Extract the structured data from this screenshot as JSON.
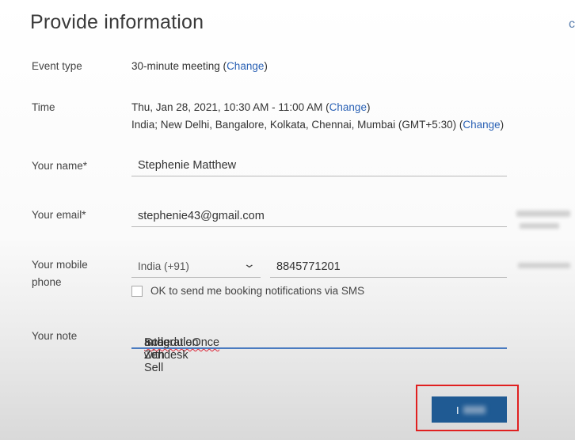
{
  "page": {
    "title": "Provide information",
    "edge_glyph": "c"
  },
  "event_type": {
    "label": "Event type",
    "value": "30-minute meeting (",
    "change": "Change",
    "close": ")"
  },
  "time": {
    "label": "Time",
    "line1": "Thu, Jan 28, 2021, 10:30 AM - 11:00 AM (",
    "line1_change": "Change",
    "line2": "India; New Delhi, Bangalore, Kolkata, Chennai, Mumbai (GMT+5:30) (",
    "line2_change": "Change",
    "close": ")"
  },
  "name": {
    "label": "Your name*",
    "value": "Stephenie Matthew"
  },
  "email": {
    "label": "Your email*",
    "value": "stephenie43@gmail.com"
  },
  "mobile": {
    "label_line1": "Your mobile",
    "label_line2": "phone",
    "country": "India (+91)",
    "number": "8845771201",
    "sms_opt_in": "OK to send me booking notifications via SMS"
  },
  "note": {
    "label": "Your note",
    "value_pre": "Integration with ",
    "value_misspelled": "ScheduleOnce",
    "value_post": " and Zendesk Sell"
  },
  "submit": {
    "label_visible": "I"
  }
}
